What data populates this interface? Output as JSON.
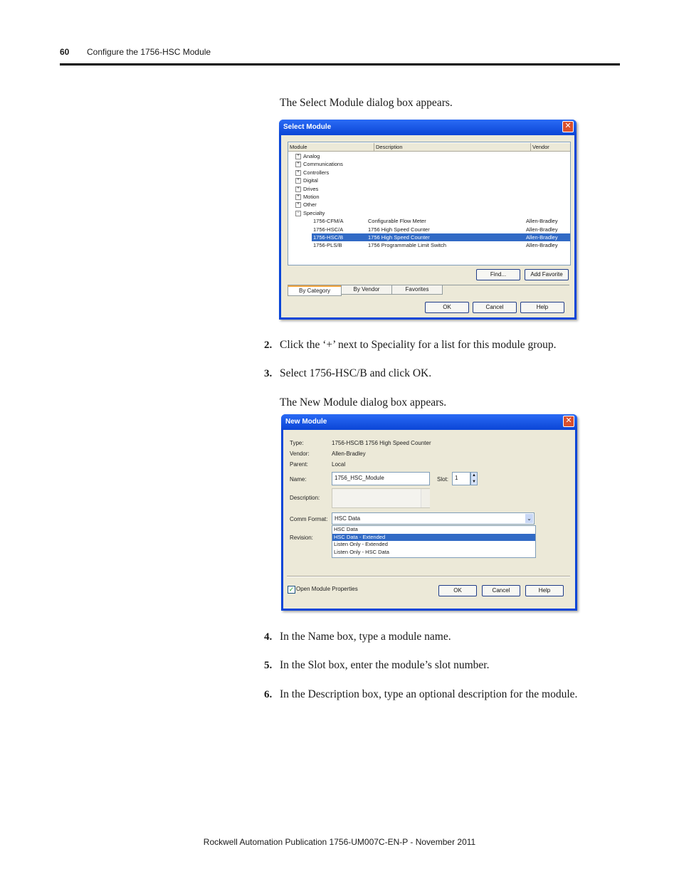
{
  "header": {
    "page_number": "60",
    "title": "Configure the 1756-HSC Module"
  },
  "intro1": "The Select Module dialog box appears.",
  "select_module": {
    "title": "Select Module",
    "columns": [
      "Module",
      "Description",
      "Vendor"
    ],
    "categories": [
      "Analog",
      "Communications",
      "Controllers",
      "Digital",
      "Drives",
      "Motion",
      "Other",
      "Specialty"
    ],
    "modules": [
      {
        "module": "1756-CFM/A",
        "description": "Configurable Flow Meter",
        "vendor": "Allen-Bradley",
        "selected": false
      },
      {
        "module": "1756-HSC/A",
        "description": "1756 High Speed Counter",
        "vendor": "Allen-Bradley",
        "selected": false
      },
      {
        "module": "1756-HSC/B",
        "description": "1756 High Speed Counter",
        "vendor": "Allen-Bradley",
        "selected": true
      },
      {
        "module": "1756-PLS/B",
        "description": "1756 Programmable Limit Switch",
        "vendor": "Allen-Bradley",
        "selected": false
      }
    ],
    "find_button": "Find...",
    "add_favorite_button": "Add Favorite",
    "tabs": [
      "By Category",
      "By Vendor",
      "Favorites"
    ],
    "ok_button": "OK",
    "cancel_button": "Cancel",
    "help_button": "Help"
  },
  "steps": [
    {
      "num": "2.",
      "text": "Click the ‘+’ next to Speciality for a list for this module group."
    },
    {
      "num": "3.",
      "text": "Select 1756-HSC/B and click OK."
    }
  ],
  "intro2": "The New Module dialog box appears.",
  "new_module": {
    "title": "New Module",
    "type_label": "Type:",
    "type_value": "1756-HSC/B 1756 High Speed Counter",
    "vendor_label": "Vendor:",
    "vendor_value": "Allen-Bradley",
    "parent_label": "Parent:",
    "parent_value": "Local",
    "name_label": "Name:",
    "name_value": "1756_HSC_Module",
    "slot_label": "Slot:",
    "slot_value": "1",
    "description_label": "Description:",
    "comm_format_label": "Comm Format:",
    "comm_format_value": "HSC Data",
    "revision_label": "Revision:",
    "options": [
      "HSC Data",
      "HSC Data - Extended",
      "Listen Only - Extended",
      "Listen Only - HSC Data"
    ],
    "selected_option_index": 1,
    "open_props_label": "Open Module Properties",
    "ok_button": "OK",
    "cancel_button": "Cancel",
    "help_button": "Help"
  },
  "steps2": [
    {
      "num": "4.",
      "text": "In the Name box, type a module name."
    },
    {
      "num": "5.",
      "text": "In the Slot box, enter the module’s slot number."
    },
    {
      "num": "6.",
      "text": "In the Description box, type an optional description for the module."
    }
  ],
  "footer": "Rockwell Automation Publication 1756-UM007C-EN-P - November 2011"
}
